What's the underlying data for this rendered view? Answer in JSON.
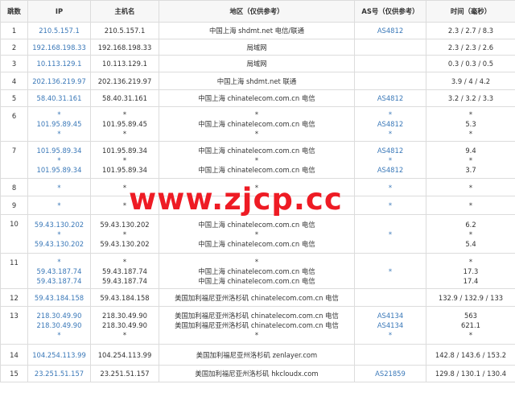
{
  "headers": [
    "跳数",
    "IP",
    "主机名",
    "地区（仅供参考）",
    "AS号（仅供参考）",
    "时间（毫秒）"
  ],
  "rows": [
    {
      "hop": "1",
      "h": 21,
      "ip": [
        "210.5.157.1"
      ],
      "host": [
        "210.5.157.1"
      ],
      "region": [
        "中国上海 shdmt.net 电信/联通"
      ],
      "asn": [
        "AS4812"
      ],
      "time": [
        "2.3 / 2.7 / 8.3"
      ]
    },
    {
      "hop": "2",
      "h": 20,
      "ip": [
        "192.168.198.33"
      ],
      "host": [
        "192.168.198.33"
      ],
      "region": [
        "局域网"
      ],
      "asn": [
        ""
      ],
      "time": [
        "2.3 / 2.3 / 2.6"
      ]
    },
    {
      "hop": "3",
      "h": 21,
      "ip": [
        "10.113.129.1"
      ],
      "host": [
        "10.113.129.1"
      ],
      "region": [
        "局域网"
      ],
      "asn": [
        ""
      ],
      "time": [
        "0.3 / 0.3 / 0.5"
      ]
    },
    {
      "hop": "4",
      "h": 22,
      "ip": [
        "202.136.219.97"
      ],
      "host": [
        "202.136.219.97"
      ],
      "region": [
        "中国上海 shdmt.net 联通"
      ],
      "asn": [
        ""
      ],
      "time": [
        "3.9 / 4 / 4.2"
      ]
    },
    {
      "hop": "5",
      "h": 21,
      "ip": [
        "58.40.31.161"
      ],
      "host": [
        "58.40.31.161"
      ],
      "region": [
        "中国上海 chinatelecom.com.cn 电信"
      ],
      "asn": [
        "AS4812"
      ],
      "time": [
        "3.2 / 3.2 / 3.3"
      ]
    },
    {
      "hop": "6",
      "h": 43,
      "ip": [
        "*",
        "101.95.89.45",
        "*"
      ],
      "host": [
        "*",
        "101.95.89.45",
        "*"
      ],
      "region": [
        "*",
        "中国上海 chinatelecom.com.cn 电信",
        "*"
      ],
      "asn": [
        "*",
        "AS4812",
        "*"
      ],
      "time": [
        "*",
        "5.3",
        "*"
      ]
    },
    {
      "hop": "7",
      "h": 46,
      "ip": [
        "101.95.89.34",
        "*",
        "101.95.89.34"
      ],
      "host": [
        "101.95.89.34",
        "*",
        "101.95.89.34"
      ],
      "region": [
        "中国上海 chinatelecom.com.cn 电信",
        "*",
        "中国上海 chinatelecom.com.cn 电信"
      ],
      "asn": [
        "AS4812",
        "*",
        "AS4812"
      ],
      "time": [
        "9.4",
        "*",
        "3.7"
      ]
    },
    {
      "hop": "8",
      "h": 22,
      "ip": [
        "*"
      ],
      "host": [
        "*"
      ],
      "region": [
        "*"
      ],
      "asn": [
        "*"
      ],
      "time": [
        "*"
      ]
    },
    {
      "hop": "9",
      "h": 23,
      "ip": [
        "*"
      ],
      "host": [
        "*"
      ],
      "region": [
        "*"
      ],
      "asn": [
        "*"
      ],
      "time": [
        "*"
      ]
    },
    {
      "hop": "10",
      "h": 48,
      "ip": [
        "59.43.130.202",
        "*",
        "59.43.130.202"
      ],
      "host": [
        "59.43.130.202",
        "*",
        "59.43.130.202"
      ],
      "region": [
        "中国上海 chinatelecom.com.cn 电信",
        "*",
        "中国上海 chinatelecom.com.cn 电信"
      ],
      "asn": [
        "*"
      ],
      "time": [
        "6.2",
        "*",
        "5.4"
      ]
    },
    {
      "hop": "11",
      "h": 44,
      "ip": [
        "*",
        "59.43.187.74",
        "59.43.187.74"
      ],
      "host": [
        "*",
        "59.43.187.74",
        "59.43.187.74"
      ],
      "region": [
        "*",
        "中国上海 chinatelecom.com.cn 电信",
        "中国上海 chinatelecom.com.cn 电信"
      ],
      "asn": [
        "*"
      ],
      "time": [
        "*",
        "17.3",
        "17.4"
      ]
    },
    {
      "hop": "12",
      "h": 22,
      "ip": [
        "59.43.184.158"
      ],
      "host": [
        "59.43.184.158"
      ],
      "region": [
        "美国加利福尼亚州洛杉矶 chinatelecom.com.cn 电信"
      ],
      "asn": [
        ""
      ],
      "time": [
        "132.9 / 132.9 / 133"
      ]
    },
    {
      "hop": "13",
      "h": 47,
      "ip": [
        "218.30.49.90",
        "218.30.49.90",
        "*"
      ],
      "host": [
        "218.30.49.90",
        "218.30.49.90",
        "*"
      ],
      "region": [
        "美国加利福尼亚州洛杉矶 chinatelecom.com.cn 电信",
        "美国加利福尼亚州洛杉矶 chinatelecom.com.cn 电信",
        "*"
      ],
      "asn": [
        "AS4134",
        "AS4134",
        "*"
      ],
      "time": [
        "563",
        "621.1",
        "*"
      ]
    },
    {
      "hop": "14",
      "h": 26,
      "ip": [
        "104.254.113.99"
      ],
      "host": [
        "104.254.113.99"
      ],
      "region": [
        "美国加利福尼亚州洛杉矶 zenlayer.com"
      ],
      "asn": [
        ""
      ],
      "time": [
        "142.8 / 143.6 / 153.2"
      ]
    },
    {
      "hop": "15",
      "h": 21,
      "ip": [
        "23.251.51.157"
      ],
      "host": [
        "23.251.51.157"
      ],
      "region": [
        "美国加利福尼亚州洛杉矶 hkcloudx.com"
      ],
      "asn": [
        "AS21859"
      ],
      "time": [
        "129.8 / 130.1 / 130.4"
      ]
    }
  ],
  "watermark": "www.zjcp.cc"
}
